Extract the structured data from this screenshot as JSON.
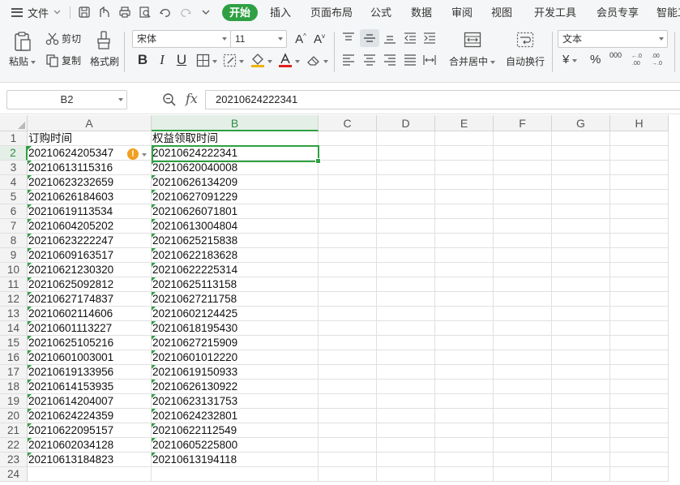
{
  "menubar": {
    "file_label": "文件",
    "tabs": [
      "开始",
      "插入",
      "页面布局",
      "公式",
      "数据",
      "审阅",
      "视图",
      "开发工具",
      "会员专享",
      "智能工"
    ],
    "active_tab": "开始"
  },
  "ribbon": {
    "paste_label": "粘贴",
    "cut_label": "剪切",
    "copy_label": "复制",
    "format_painter_label": "格式刷",
    "font_name": "宋体",
    "font_size": "11",
    "bold": "B",
    "italic": "I",
    "underline": "U",
    "merge_label": "合并居中",
    "wrap_label": "自动换行",
    "number_format": "文本",
    "currency": "¥",
    "percent": "%",
    "thousands": "000"
  },
  "formula_bar": {
    "name_box": "B2",
    "fx": "fx",
    "value": "20210624222341"
  },
  "sheet": {
    "columns": [
      "A",
      "B",
      "C",
      "D",
      "E",
      "F",
      "G",
      "H"
    ],
    "selected_column": "B",
    "selected_row": 2,
    "rows": [
      [
        "订购时间",
        "权益领取时间"
      ],
      [
        "20210624205347",
        "20210624222341"
      ],
      [
        "20210613115316",
        "20210620040008"
      ],
      [
        "20210623232659",
        "20210626134209"
      ],
      [
        "20210626184603",
        "20210627091229"
      ],
      [
        "20210619113534",
        "20210626071801"
      ],
      [
        "20210604205202",
        "20210613004804"
      ],
      [
        "20210623222247",
        "20210625215838"
      ],
      [
        "20210609163517",
        "20210622183628"
      ],
      [
        "20210621230320",
        "20210622225314"
      ],
      [
        "20210625092812",
        "20210625113158"
      ],
      [
        "20210627174837",
        "20210627211758"
      ],
      [
        "20210602114606",
        "20210602124425"
      ],
      [
        "20210601113227",
        "20210618195430"
      ],
      [
        "20210625105216",
        "20210627215909"
      ],
      [
        "20210601003001",
        "20210601012220"
      ],
      [
        "20210619133956",
        "20210619150933"
      ],
      [
        "20210614153935",
        "20210626130922"
      ],
      [
        "20210614204007",
        "20210623131753"
      ],
      [
        "20210624224359",
        "20210624232801"
      ],
      [
        "20210622095157",
        "20210622112549"
      ],
      [
        "20210602034128",
        "20210605225800"
      ],
      [
        "20210613184823",
        "20210613194118"
      ],
      [
        "",
        ""
      ]
    ]
  }
}
